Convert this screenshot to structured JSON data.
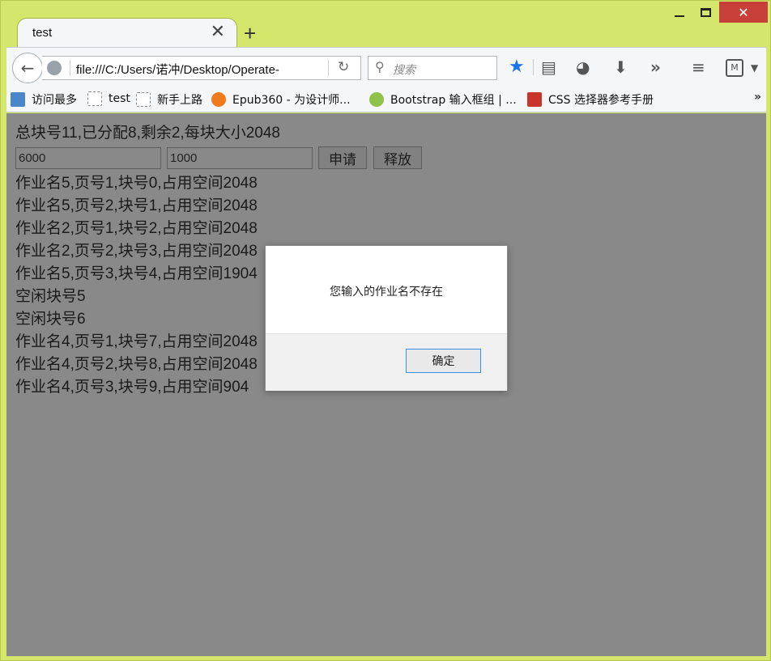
{
  "window": {
    "close_glyph": "✕"
  },
  "tab": {
    "title": "test",
    "close_glyph": "✕",
    "new_tab_glyph": "+"
  },
  "toolbar": {
    "back_glyph": "←",
    "url": "file:///C:/Users/诺冲/Desktop/Operate-",
    "reload_glyph": "↻",
    "search_placeholder": "搜索",
    "overflow_glyph": "»",
    "menu_glyph": "≡",
    "extension_label": "M",
    "extension_dropdown_glyph": "▼"
  },
  "bookmarks": {
    "items": [
      {
        "label": "访问最多",
        "icon": "most-visited-icon"
      },
      {
        "label": "test",
        "icon": "page-icon"
      },
      {
        "label": "新手上路",
        "icon": "page-icon"
      },
      {
        "label": "Epub360 - 为设计师...",
        "icon": "epub-icon"
      },
      {
        "label": "Bootstrap 输入框组 | ...",
        "icon": "runoob-icon"
      },
      {
        "label": "CSS 选择器参考手册",
        "icon": "w3school-icon"
      }
    ],
    "more_glyph": "»"
  },
  "page": {
    "summary": "总块号11,已分配8,剩余2,每块大小2048",
    "inputs": {
      "first_value": "6000",
      "second_value": "1000"
    },
    "buttons": {
      "apply": "申请",
      "release": "释放"
    },
    "lines": [
      "作业名5,页号1,块号0,占用空间2048",
      "作业名5,页号2,块号1,占用空间2048",
      "作业名2,页号1,块号2,占用空间2048",
      "作业名2,页号2,块号3,占用空间2048",
      "作业名5,页号3,块号4,占用空间1904",
      "空闲块号5",
      "空闲块号6",
      "作业名4,页号1,块号7,占用空间2048",
      "作业名4,页号2,块号8,占用空间2048",
      "作业名4,页号3,块号9,占用空间904"
    ]
  },
  "dialog": {
    "message": "您输入的作业名不存在",
    "ok_label": "确定"
  }
}
